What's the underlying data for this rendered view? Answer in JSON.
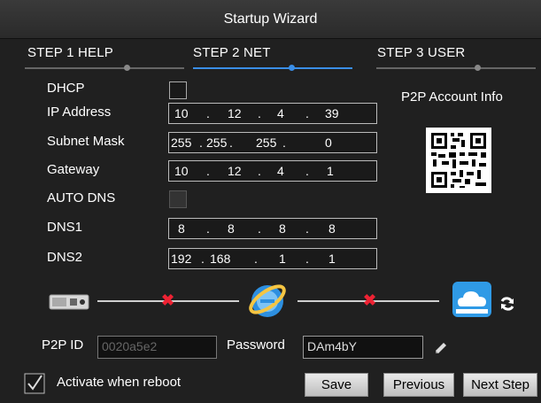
{
  "window": {
    "title": "Startup Wizard"
  },
  "steps": [
    {
      "label": "STEP 1 HELP"
    },
    {
      "label": "STEP 2 NET"
    },
    {
      "label": "STEP 3 USER"
    }
  ],
  "net": {
    "dhcp_label": "DHCP",
    "dhcp_checked": false,
    "ip_label": "IP Address",
    "ip": [
      "10",
      "12",
      "4",
      "39"
    ],
    "subnet_label": "Subnet Mask",
    "subnet": [
      "255",
      "255",
      "255",
      "0"
    ],
    "gateway_label": "Gateway",
    "gateway": [
      "10",
      "12",
      "4",
      "1"
    ],
    "autodns_label": "AUTO DNS",
    "autodns_checked": false,
    "dns1_label": "DNS1",
    "dns1": [
      "8",
      "8",
      "8",
      "8"
    ],
    "dns2_label": "DNS2",
    "dns2": [
      "192",
      "168",
      "1",
      "1"
    ]
  },
  "p2p": {
    "title": "P2P Account Info",
    "id_label": "P2P ID",
    "id_value": "0020a5e2",
    "password_label": "Password",
    "password_value": "DAm4bY"
  },
  "footer": {
    "activate_label": "Activate when reboot",
    "activate_checked": true,
    "save": "Save",
    "previous": "Previous",
    "next": "Next Step"
  },
  "icons": [
    "dvr-device-icon",
    "internet-globe-icon",
    "cloud-icon",
    "refresh-icon",
    "edit-pencil-icon",
    "error-x-icon"
  ],
  "colors": {
    "accent": "#3a8ee6",
    "error": "#e22233"
  }
}
